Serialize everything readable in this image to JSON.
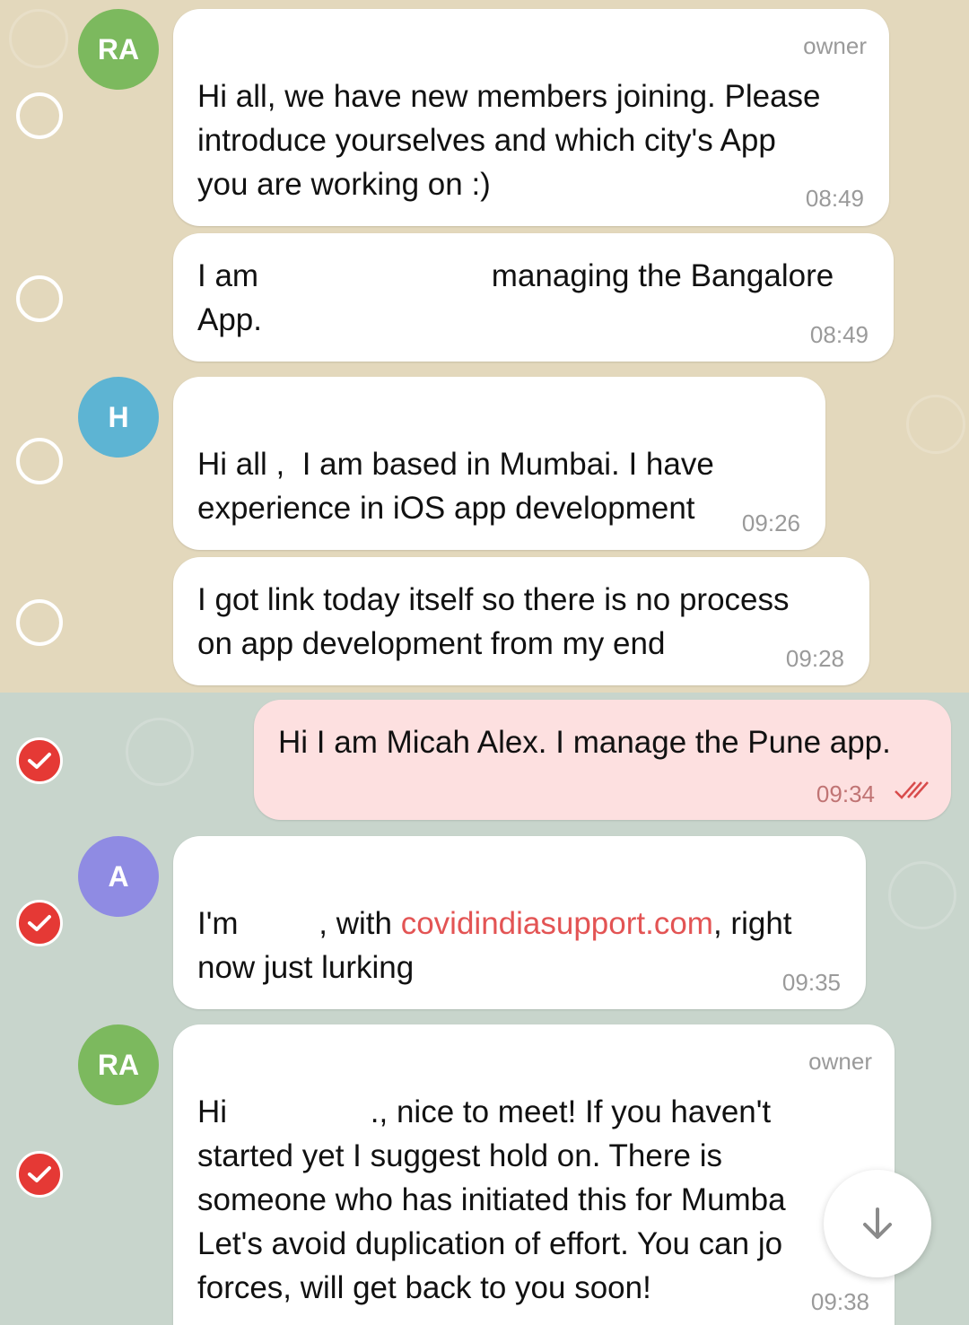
{
  "colors": {
    "avatar_ra": "#7cb95e",
    "avatar_h": "#5db4d3",
    "avatar_a": "#8f8be3",
    "link": "#e35454",
    "check": "#e53935"
  },
  "messages": [
    {
      "avatar": "RA",
      "role": "owner",
      "text": "Hi all, we have new members joining. Please\nintroduce yourselves and which city's App\nyou are working on :)",
      "time": "08:49",
      "selected": false
    },
    {
      "text_part1": "I am ",
      "text_part2": "managing the Bangalore\nApp.",
      "time": "08:49",
      "selected": false
    },
    {
      "avatar": "H",
      "text": "Hi all ,  I am based in Mumbai. I have\nexperience in iOS app development",
      "time": "09:26",
      "selected": false
    },
    {
      "text": "I got link today itself so there is no process\non app development from my end",
      "time": "09:28",
      "selected": false
    },
    {
      "outgoing": true,
      "text": "Hi I am Micah Alex. I manage the Pune app.",
      "time": "09:34",
      "status_icon": "double-check-icon",
      "selected": true
    },
    {
      "avatar": "A",
      "text_part1": "I'm ",
      "text_part2": ", with ",
      "link": "covidindiasupport.com",
      "text_part3": ", right\nnow just lurking",
      "time": "09:35",
      "selected": true
    },
    {
      "avatar": "RA",
      "role": "owner",
      "text_part1": "Hi ",
      "text_part2": "., nice to meet! If you haven't\nstarted yet I suggest hold on. There is\nsomeone who has initiated this for Mumba\nLet's avoid duplication of effort. You can jo\nforces, will get back to you soon!",
      "time": "09:38",
      "selected": true
    }
  ],
  "scroll_button": {
    "icon": "arrow-down-icon"
  }
}
